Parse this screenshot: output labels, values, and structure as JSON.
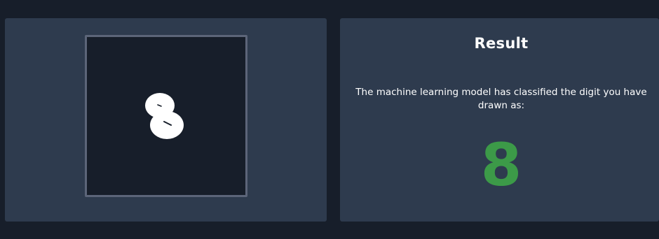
{
  "drawing_panel": {
    "canvas_stroke_color": "#ffffff",
    "canvas_background": "#171e2a"
  },
  "result_panel": {
    "title": "Result",
    "description": "The machine learning model has classified the digit you have drawn as:",
    "predicted_digit": "8",
    "digit_color": "#3c9a48"
  }
}
